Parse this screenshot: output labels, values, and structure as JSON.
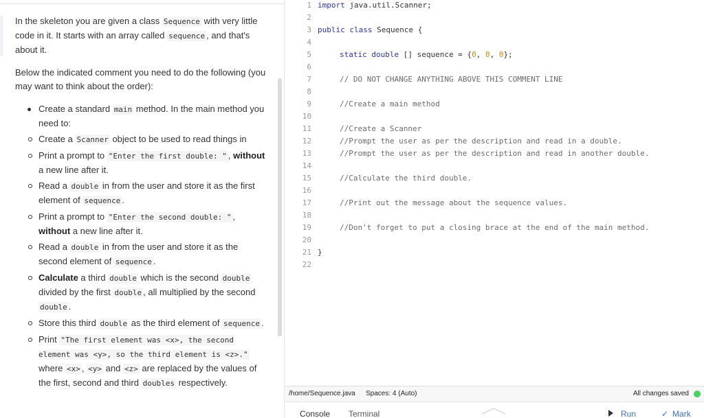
{
  "instructions": {
    "p1": [
      "In the skeleton you are given a class ",
      "Sequence",
      " with very little code in it. It starts with an array called ",
      "sequence",
      ", and that's about it."
    ],
    "p2": "Below the indicated comment you need to do the following (you may want to think about the order):",
    "main": [
      "Create a standard ",
      "main",
      " method. In the main method you need to:"
    ],
    "steps": {
      "s1": [
        "Create a ",
        "Scanner",
        " object to be used to read things in"
      ],
      "s2": [
        "Print a prompt to ",
        "\"Enter the first double: \"",
        ", ",
        "without",
        " a new line after it."
      ],
      "s3": [
        "Read a ",
        "double",
        " in from the user and store it as the first element of ",
        "sequence",
        "."
      ],
      "s4": [
        "Print a prompt to ",
        "\"Enter the second double: \"",
        ", ",
        "without",
        " a new line after it."
      ],
      "s5": [
        "Read a ",
        "double",
        " in from the user and store it as the second element of ",
        "sequence",
        "."
      ],
      "s6": [
        "Calculate",
        " a third ",
        "double",
        " which is the second ",
        "double",
        " divided by the first ",
        "double",
        ", all multiplied by the second ",
        "double",
        "."
      ],
      "s7": [
        "Store this third ",
        "double",
        " as the third element of ",
        "sequence",
        "."
      ],
      "s8": [
        "Print ",
        "\"The first element was <x>, the second element was <y>, so the third element is <z>.\"",
        " where ",
        "<x>",
        ", ",
        "<y>",
        " and ",
        "<z>",
        " are replaced by the values of the first, second and third ",
        "doubles",
        " respectively."
      ]
    }
  },
  "editor": {
    "line_numbers": [
      "1",
      "2",
      "3",
      "4",
      "5",
      "6",
      "7",
      "8",
      "9",
      "10",
      "11",
      "12",
      "13",
      "14",
      "15",
      "16",
      "17",
      "18",
      "19",
      "20",
      "21",
      "22"
    ],
    "l1": [
      "import",
      " java.util.Scanner;"
    ],
    "l3": [
      "public class",
      " Sequence {"
    ],
    "l5": [
      "static double",
      " [] sequence = {",
      "0",
      ", ",
      "0",
      ", ",
      "0",
      "};"
    ],
    "l7": "// DO NOT CHANGE ANYTHING ABOVE THIS COMMENT LINE",
    "l9": "//Create a main method",
    "l11": "//Create a Scanner",
    "l12": "//Prompt the user as per the description and read in a double.",
    "l13": "//Prompt the user as per the description and read in another double.",
    "l15": "//Calculate the third double.",
    "l17": "//Print out the message about the sequence values.",
    "l19": "//Don't forget to put a closing brace at the end of the main method.",
    "l21": "}"
  },
  "status": {
    "path": "/home/Sequence.java",
    "spaces": "Spaces: 4 (Auto)",
    "saved": "All changes saved",
    "saved_color": "#4bd35d"
  },
  "bottom": {
    "console": "Console",
    "terminal": "Terminal",
    "run": "Run",
    "mark": "Mark",
    "mark_check": "✓"
  }
}
